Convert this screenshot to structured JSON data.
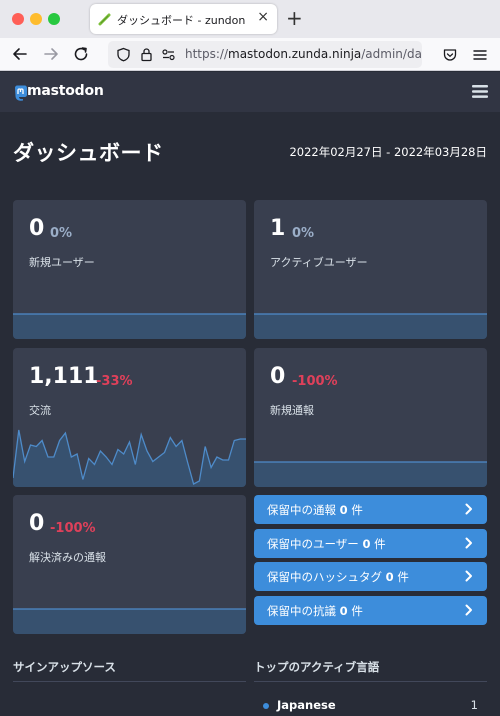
{
  "browser": {
    "tab_title": "ダッシュボード - zundon",
    "tab_close": "×",
    "new_tab": "+",
    "url_scheme": "https://",
    "url_host": "mastodon.zunda.ninja",
    "url_path": "/admin/da"
  },
  "header": {
    "logo_text": "mastodon"
  },
  "page": {
    "title": "ダッシュボード",
    "date_range": "2022年02月27日 - 2022年03月28日"
  },
  "metrics": [
    {
      "value": "0",
      "delta": "0%",
      "label": "新規ユーザー",
      "delta_color": "#9baec8"
    },
    {
      "value": "1",
      "delta": "0%",
      "label": "アクティブユーザー",
      "delta_color": "#9baec8"
    },
    {
      "value": "1,111",
      "delta": "-33%",
      "label": "交流",
      "delta_color": "#df405a"
    },
    {
      "value": "0",
      "delta": "-100%",
      "label": "新規通報",
      "delta_color": "#df405a"
    },
    {
      "value": "0",
      "delta": "-100%",
      "label": "解決済みの通報",
      "delta_color": "#df405a"
    }
  ],
  "interactions_sparkline": [
    6,
    38,
    17,
    28,
    27,
    31,
    20,
    20,
    31,
    36,
    20,
    22,
    5,
    19,
    15,
    24,
    20,
    15,
    25,
    22,
    30,
    15,
    35,
    24,
    17,
    20,
    23,
    33,
    27,
    31,
    16,
    2,
    4,
    27,
    13,
    20,
    18,
    18,
    31,
    32,
    32
  ],
  "pending": [
    {
      "prefix": "保留中の通報",
      "count": "0",
      "suffix": "件"
    },
    {
      "prefix": "保留中のユーザー",
      "count": "0",
      "suffix": "件"
    },
    {
      "prefix": "保留中のハッシュタグ",
      "count": "0",
      "suffix": "件"
    },
    {
      "prefix": "保留中の抗議",
      "count": "0",
      "suffix": "件"
    }
  ],
  "sections": {
    "signup_sources": "サインアップソース",
    "top_languages": "トップのアクティブ言語"
  },
  "languages": [
    {
      "name": "Japanese",
      "count": "1"
    }
  ],
  "colors": {
    "accent": "#3d8ddb",
    "negative": "#df405a",
    "card": "#393f4f",
    "background": "#282c37"
  }
}
